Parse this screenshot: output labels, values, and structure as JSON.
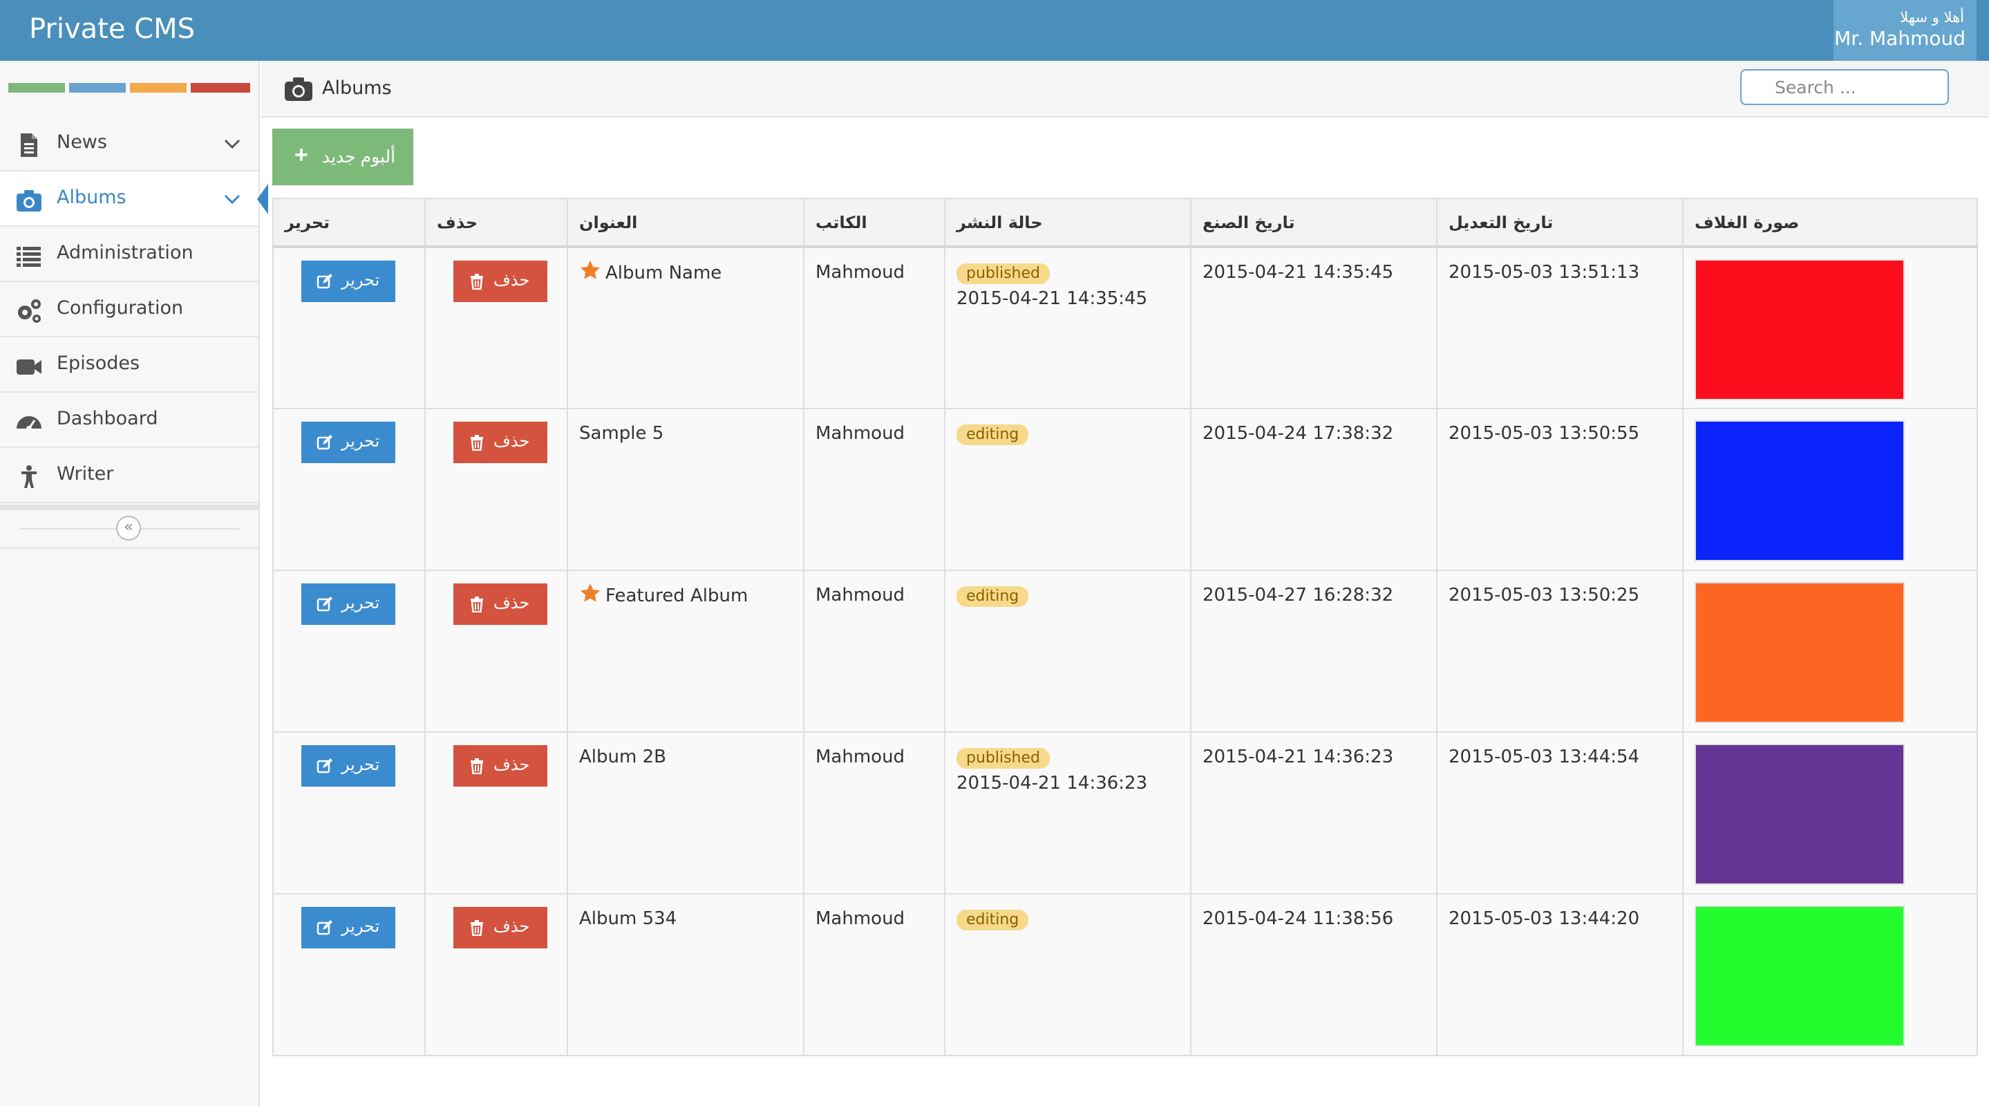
{
  "app": {
    "title": "Private CMS",
    "greeting": "أهلا و سهلا",
    "user_name": "Mr. Mahmoud"
  },
  "colors": {
    "navbar": "#4a8fbb",
    "green": "#7dba79",
    "blue": "#6aa2cf",
    "orange": "#f3a94b",
    "red": "#c9493c"
  },
  "sidebar": {
    "items": [
      {
        "label": "News",
        "icon": "document-icon"
      },
      {
        "label": "Albums",
        "icon": "camera-icon"
      },
      {
        "label": "Administration",
        "icon": "list-icon"
      },
      {
        "label": "Configuration",
        "icon": "gears-icon"
      },
      {
        "label": "Episodes",
        "icon": "video-camera-icon"
      },
      {
        "label": "Dashboard",
        "icon": "dashboard-icon"
      },
      {
        "label": "Writer",
        "icon": "person-icon"
      }
    ],
    "collapse_glyph": "«"
  },
  "breadcrumb": {
    "title": "Albums",
    "icon": "camera-icon"
  },
  "search": {
    "placeholder": "Search ..."
  },
  "toolbar": {
    "new_album_label": "ألبوم جديد",
    "plus": "+"
  },
  "table": {
    "headers": {
      "edit": "تحرير",
      "delete": "حذف",
      "title": "العنوان",
      "writer": "الكاتب",
      "status": "حالة النشر",
      "created": "تاريخ الصنع",
      "modified": "تاريخ التعديل",
      "cover": "صورة الغلاف"
    },
    "edit_label": "تحرير",
    "delete_label": "حذف",
    "rows": [
      {
        "title": "Album Name",
        "featured": true,
        "writer": "Mahmoud",
        "status": "published",
        "published_at": "2015-04-21 14:35:45",
        "created": "2015-04-21 14:35:45",
        "modified": "2015-05-03 13:51:13",
        "cover_color": "#fc0d1b"
      },
      {
        "title": "Sample 5",
        "featured": false,
        "writer": "Mahmoud",
        "status": "editing",
        "published_at": "",
        "created": "2015-04-24 17:38:32",
        "modified": "2015-05-03 13:50:55",
        "cover_color": "#0b24fb"
      },
      {
        "title": "Featured Album",
        "featured": true,
        "writer": "Mahmoud",
        "status": "editing",
        "published_at": "",
        "created": "2015-04-27 16:28:32",
        "modified": "2015-05-03 13:50:25",
        "cover_color": "#fd6522"
      },
      {
        "title": "Album 2B",
        "featured": false,
        "writer": "Mahmoud",
        "status": "published",
        "published_at": "2015-04-21 14:36:23",
        "created": "2015-04-21 14:36:23",
        "modified": "2015-05-03 13:44:54",
        "cover_color": "#663494"
      },
      {
        "title": "Album 534",
        "featured": false,
        "writer": "Mahmoud",
        "status": "editing",
        "published_at": "",
        "created": "2015-04-24 11:38:56",
        "modified": "2015-05-03 13:44:20",
        "cover_color": "#24fc2e"
      }
    ]
  }
}
